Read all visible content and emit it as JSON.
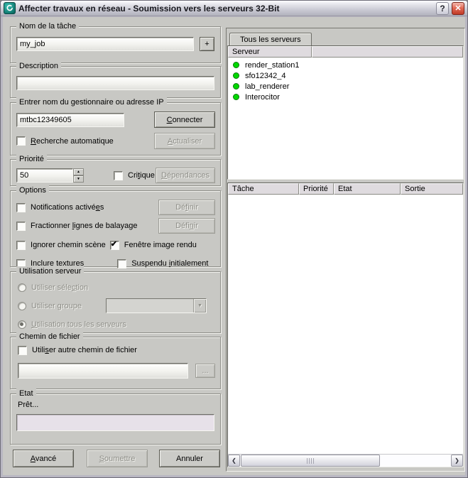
{
  "window": {
    "title": "Affecter travaux en réseau - Soumission vers les serveurs 32-Bit",
    "help": "?",
    "close": "✕"
  },
  "job": {
    "legend": "Nom de la tâche",
    "name": "my_job",
    "add_button": "+"
  },
  "description": {
    "legend": "Description",
    "value": ""
  },
  "manager": {
    "legend": "Entrer nom du gestionnaire ou adresse IP",
    "address": "mtbc12349605",
    "connect": "Connecter",
    "auto_search": "Recherche automatique",
    "auto_search_checked": false,
    "refresh": "Actualiser"
  },
  "priority": {
    "legend": "Priorité",
    "value": "50",
    "critical": "Critique",
    "critical_checked": false,
    "dependencies": "Dépendances"
  },
  "options": {
    "legend": "Options",
    "notifications": "Notifications activées",
    "notifications_checked": false,
    "define_a": "Définir",
    "split_scanlines": "Fractionner lignes de balayage",
    "split_checked": false,
    "define_b": "Définir",
    "ignore_scene_path": "Ignorer chemin scène",
    "ignore_checked": false,
    "rendered_frame_window": "Fenêtre image rendu",
    "rendered_frame_checked": true,
    "include_maps": "Inclure textures",
    "include_maps_checked": false,
    "initially_suspended": "Suspendu initialement",
    "suspended_checked": false
  },
  "server_usage": {
    "legend": "Utilisation serveur",
    "use_selected": "Utiliser sélection",
    "selection_selected": false,
    "use_group": "Utiliser groupe",
    "group_selected": false,
    "group_value": "",
    "use_all": "Utilisation tous les serveurs",
    "all_selected": true
  },
  "file_path": {
    "legend": "Chemin de fichier",
    "use_alternate": "Utiliser autre chemin de fichier",
    "use_alternate_checked": false,
    "path": "",
    "browse": "..."
  },
  "status": {
    "legend": "Etat",
    "message": "Prêt...",
    "progress": ""
  },
  "footer": {
    "advanced": "Avancé",
    "submit": "Soumettre",
    "cancel": "Annuler"
  },
  "servers_panel": {
    "tab": "Tous les serveurs",
    "header": "Serveur",
    "header_filler": "",
    "status_dot_color": "#00d800",
    "servers": [
      {
        "name": "render_station1"
      },
      {
        "name": "sfo12342_4"
      },
      {
        "name": "lab_renderer"
      },
      {
        "name": "Interocitor"
      }
    ]
  },
  "jobs_panel": {
    "columns": [
      "Tâche",
      "Priorité",
      "Etat",
      "Sortie"
    ],
    "rows": []
  },
  "colors": {
    "dialog_bg": "#c8c8c4",
    "titlebar_close": "#c13a27",
    "status_field": "#e7e1e9",
    "header_cell": "#dfdbdf",
    "server_ok_green": "#00d800"
  }
}
